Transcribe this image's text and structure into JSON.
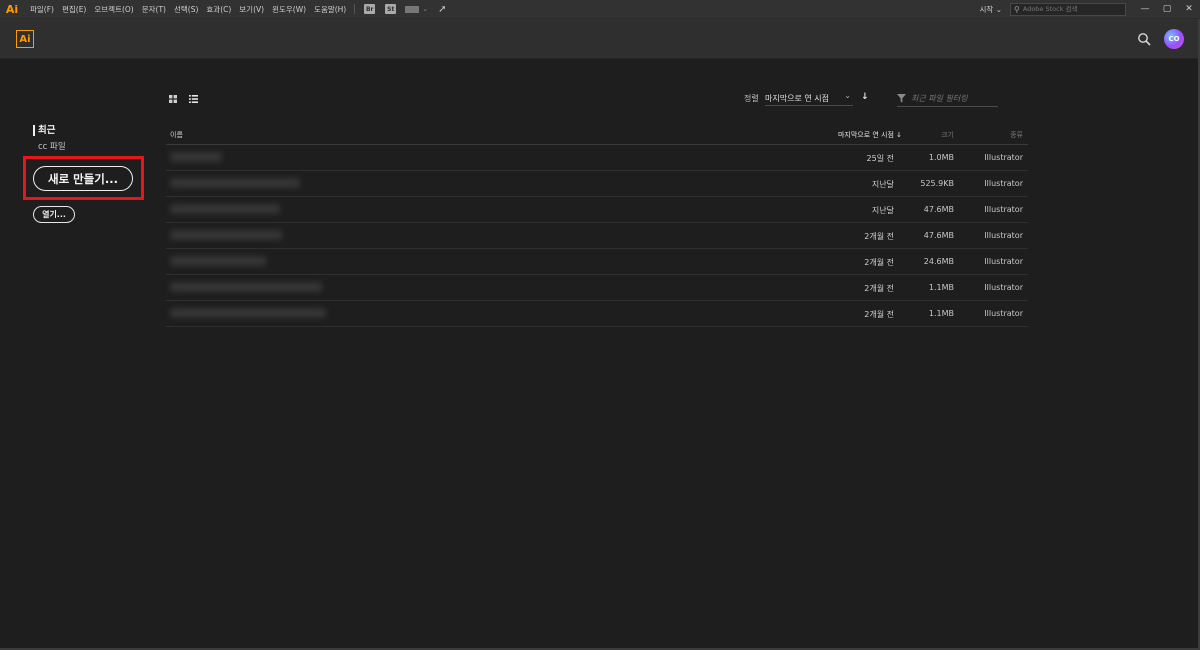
{
  "menubar": {
    "app_icon": "Ai",
    "items": [
      "파일(F)",
      "편집(E)",
      "오브젝트(O)",
      "문자(T)",
      "선택(S)",
      "효과(C)",
      "보기(V)",
      "윈도우(W)",
      "도움말(H)"
    ],
    "bridge_badge": "Br",
    "stock_badge": "St",
    "workspace_label": "시작",
    "workspace_chevron": "⌄",
    "stock_search_placeholder": "Adobe Stock 검색",
    "window_controls": [
      "—",
      "▢",
      "✕"
    ]
  },
  "appbar": {
    "logo": "Ai",
    "avatar_text": "CO"
  },
  "nav": {
    "recent": "최근",
    "cc_files": "cc 파일",
    "new_button": "새로 만들기...",
    "open_button": "열기..."
  },
  "toolbar": {
    "sort_label": "정렬",
    "sort_value": "마지막으로 연 시점",
    "sort_chevron": "⌄",
    "sort_direction": "↓",
    "filter_placeholder": "최근 파일 필터링"
  },
  "table": {
    "columns": {
      "name": "이름",
      "modified": "마지막으로 연 시점 ↓",
      "size": "크기",
      "type": "종류"
    },
    "rows": [
      {
        "modified": "25일 전",
        "size": "1.0MB",
        "type": "Illustrator"
      },
      {
        "modified": "지난달",
        "size": "525.9KB",
        "type": "Illustrator"
      },
      {
        "modified": "지난달",
        "size": "47.6MB",
        "type": "Illustrator"
      },
      {
        "modified": "2개월 전",
        "size": "47.6MB",
        "type": "Illustrator"
      },
      {
        "modified": "2개월 전",
        "size": "24.6MB",
        "type": "Illustrator"
      },
      {
        "modified": "2개월 전",
        "size": "1.1MB",
        "type": "Illustrator"
      },
      {
        "modified": "2개월 전",
        "size": "1.1MB",
        "type": "Illustrator"
      }
    ]
  },
  "colors": {
    "accent_orange": "#ff9a00",
    "highlight_red": "#e5171b",
    "background": "#1e1e1e"
  }
}
